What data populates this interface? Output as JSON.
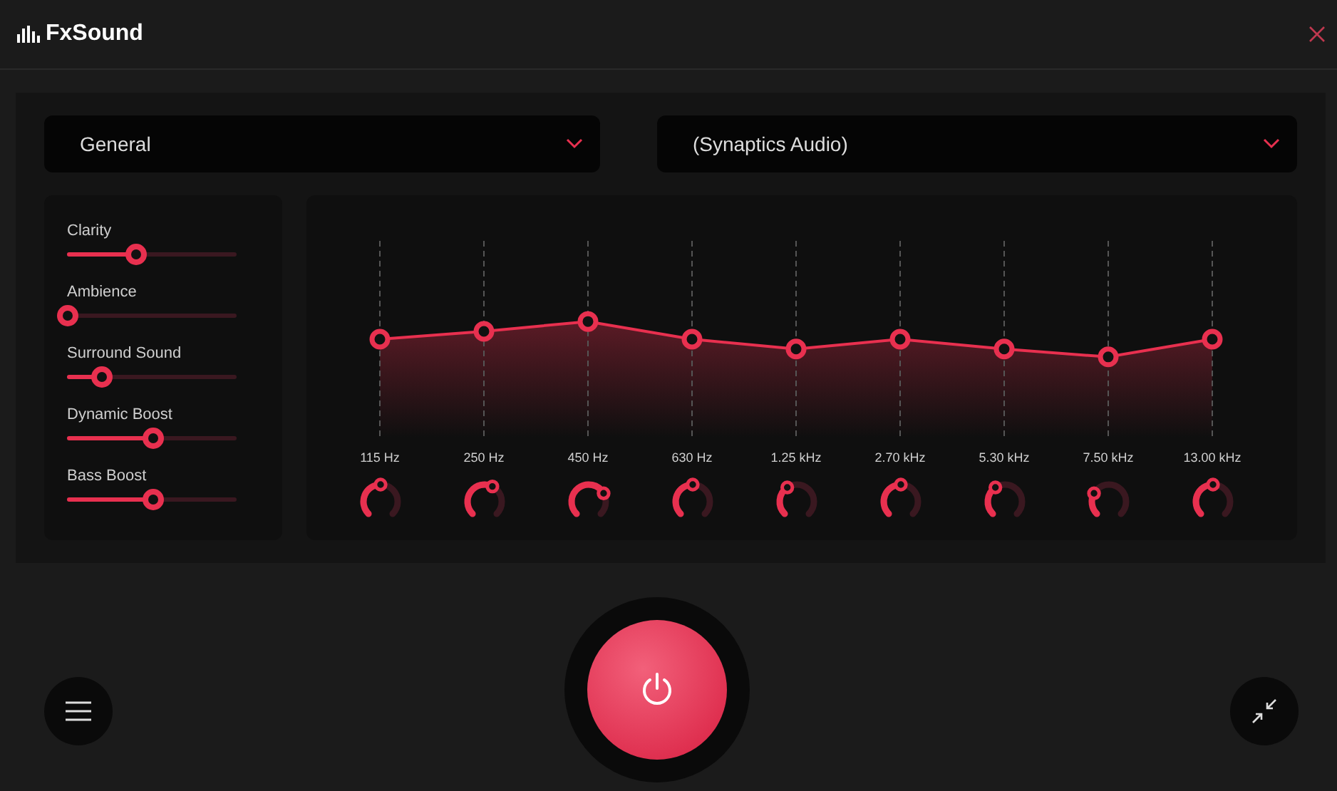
{
  "app": {
    "title": "FxSound"
  },
  "preset": {
    "value": "General"
  },
  "device": {
    "value": "(Synaptics Audio)"
  },
  "effects": [
    {
      "label": "Clarity",
      "level": 0.4
    },
    {
      "label": "Ambience",
      "level": 0
    },
    {
      "label": "Surround Sound",
      "level": 0.2
    },
    {
      "label": "Dynamic Boost",
      "level": 0.5
    },
    {
      "label": "Bass Boost",
      "level": 0.5
    }
  ],
  "bands": [
    {
      "label": "115 Hz",
      "level": 0.5
    },
    {
      "label": "250 Hz",
      "level": 0.54
    },
    {
      "label": "450 Hz",
      "level": 0.59
    },
    {
      "label": "630 Hz",
      "level": 0.5
    },
    {
      "label": "1.25 kHz",
      "level": 0.45
    },
    {
      "label": "2.70 kHz",
      "level": 0.5
    },
    {
      "label": "5.30 kHz",
      "level": 0.45
    },
    {
      "label": "7.50 kHz",
      "level": 0.41
    },
    {
      "label": "13.00 kHz",
      "level": 0.5
    }
  ],
  "power": {
    "on": true
  }
}
